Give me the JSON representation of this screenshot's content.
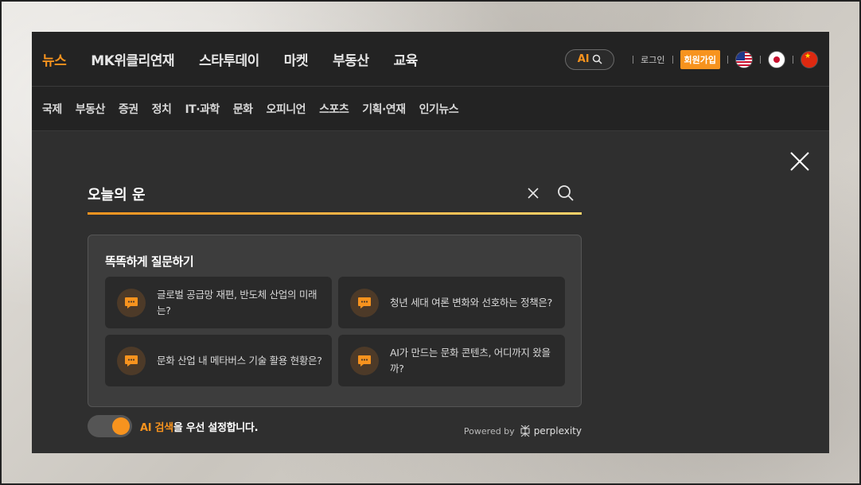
{
  "topnav": {
    "items": [
      "뉴스",
      "MK위클리연재",
      "스타투데이",
      "마켓",
      "부동산",
      "교육"
    ],
    "ai_label": "AI",
    "login": "로그인",
    "signup": "회원가입"
  },
  "subnav": {
    "items": [
      "국제",
      "부동산",
      "증권",
      "정치",
      "IT·과학",
      "문화",
      "오피니언",
      "스포츠",
      "기획·연재",
      "인기뉴스"
    ]
  },
  "search": {
    "value": "오늘의 운"
  },
  "suggestions": {
    "title": "똑똑하게 질문하기",
    "cards": [
      "글로벌 공급망 재편, 반도체 산업의 미래는?",
      "청년 세대 여론 변화와 선호하는 정책은?",
      "문화 산업 내 메타버스 기술 활용 현황은?",
      "AI가 만드는 문화 콘텐츠, 어디까지 왔을까?"
    ]
  },
  "toggle": {
    "on": true,
    "label_highlight": "AI 검색",
    "label_rest": "을 우선 설정합니다."
  },
  "powered": {
    "by": "Powered by",
    "brand": "perplexity"
  },
  "colors": {
    "accent": "#f7931e",
    "nav_bg": "#232323",
    "panel_bg": "#2f2f2f"
  }
}
